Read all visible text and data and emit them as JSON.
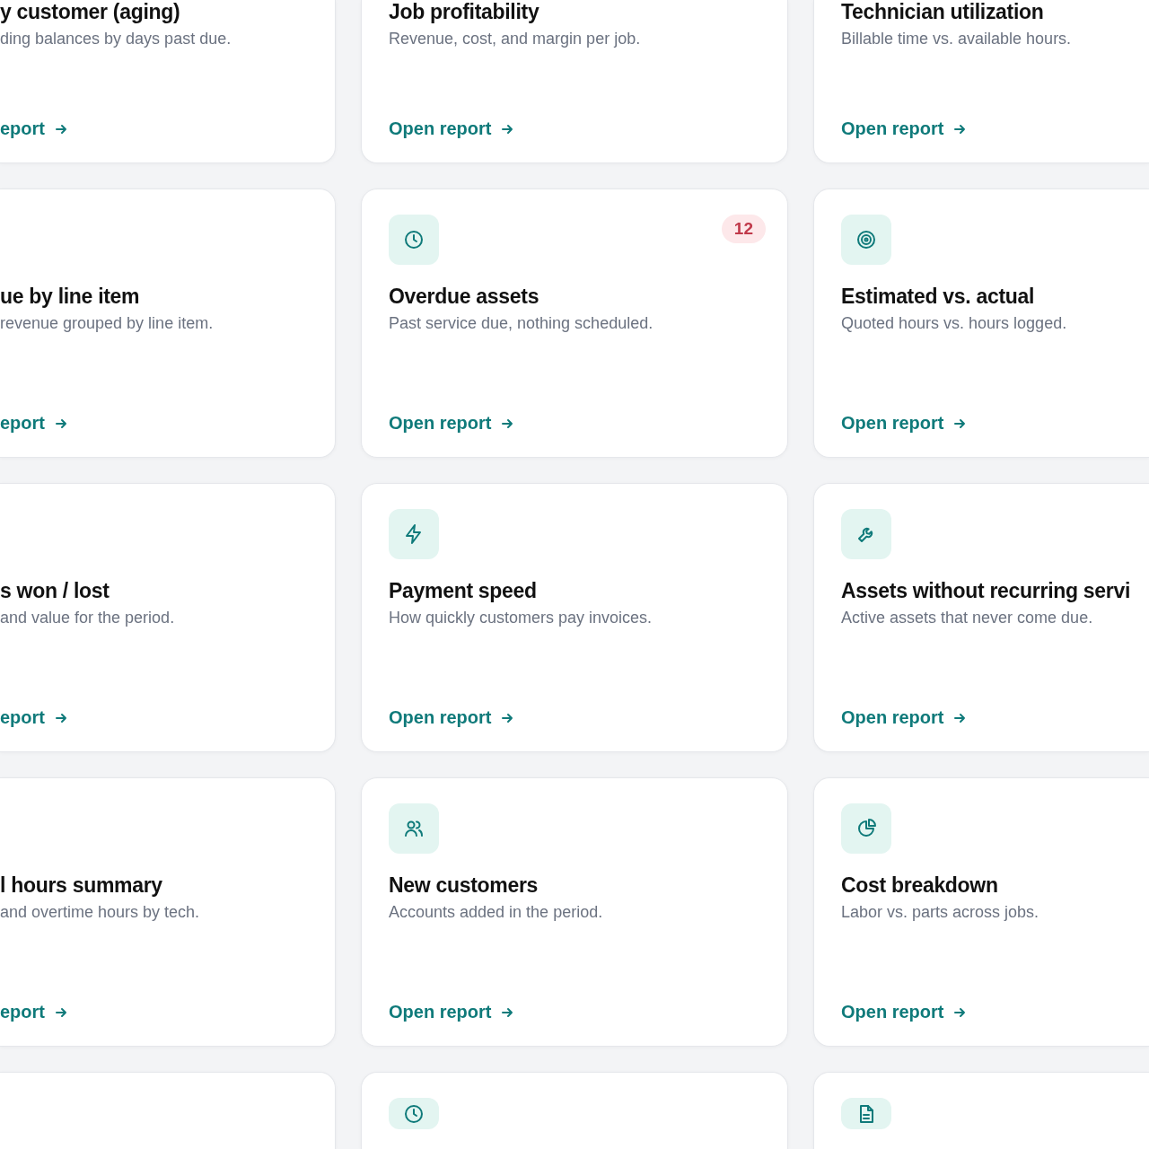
{
  "rows": [
    {
      "cards": [
        {
          "title": "y customer (aging)",
          "description": "ding balances by days past due.",
          "link": "eport"
        },
        {
          "title": "Job profitability",
          "description": "Revenue, cost, and margin per job.",
          "link": "Open report"
        },
        {
          "title": "Technician utilization",
          "description": "Billable time vs. available hours.",
          "link": "Open report"
        }
      ]
    },
    {
      "cards": [
        {
          "title": "ue by line item",
          "description": "revenue grouped by line item.",
          "link": "eport"
        },
        {
          "title": "Overdue assets",
          "description": "Past service due, nothing scheduled.",
          "link": "Open report",
          "badge": "12"
        },
        {
          "title": "Estimated vs. actual",
          "description": "Quoted hours vs. hours logged.",
          "link": "Open report"
        }
      ]
    },
    {
      "cards": [
        {
          "title": "s won / lost",
          "description": "and value for the period.",
          "link": "eport"
        },
        {
          "title": "Payment speed",
          "description": "How quickly customers pay invoices.",
          "link": "Open report"
        },
        {
          "title": "Assets without recurring servi",
          "description": "Active assets that never come due.",
          "link": "Open report"
        }
      ]
    },
    {
      "cards": [
        {
          "title": "l hours summary",
          "description": "and overtime hours by tech.",
          "link": "eport"
        },
        {
          "title": "New customers",
          "description": "Accounts added in the period.",
          "link": "Open report"
        },
        {
          "title": "Cost breakdown",
          "description": "Labor vs. parts across jobs.",
          "link": "Open report"
        }
      ]
    }
  ]
}
